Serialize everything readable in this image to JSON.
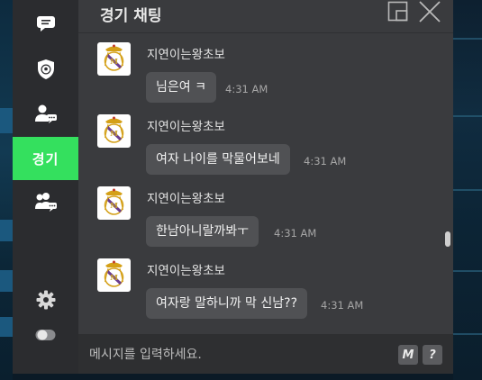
{
  "window": {
    "title": "경기 채팅"
  },
  "sidebar": {
    "items": [
      {
        "icon": "chat-bubble-icon"
      },
      {
        "icon": "shield-ball-icon"
      },
      {
        "icon": "user-chat-icon"
      },
      {
        "label": "경기",
        "active": true
      },
      {
        "icon": "group-chat-icon"
      }
    ],
    "settings_icon": "gear-icon",
    "toggle_icon": "toggle-icon"
  },
  "messages": [
    {
      "sender": "지연이는왕초보",
      "text": "님은여 ㅋ",
      "time": "4:31 AM"
    },
    {
      "sender": "지연이는왕초보",
      "text": "여자 나이를 막물어보네",
      "time": "4:31 AM"
    },
    {
      "sender": "지연이는왕초보",
      "text": "한남아니랄까봐ㅜ",
      "time": "4:31 AM"
    },
    {
      "sender": "지연이는왕초보",
      "text": "여자랑 말하니까 막 신남??",
      "time": "4:31 AM"
    }
  ],
  "input": {
    "placeholder": "메시지를 입력하세요."
  },
  "buttons": {
    "macro_label": "M",
    "help_label": "?"
  },
  "colors": {
    "accent": "#34e05e",
    "panel": "#3a3b3e",
    "sidebar": "#2b2c2f",
    "bubble": "#505154"
  }
}
